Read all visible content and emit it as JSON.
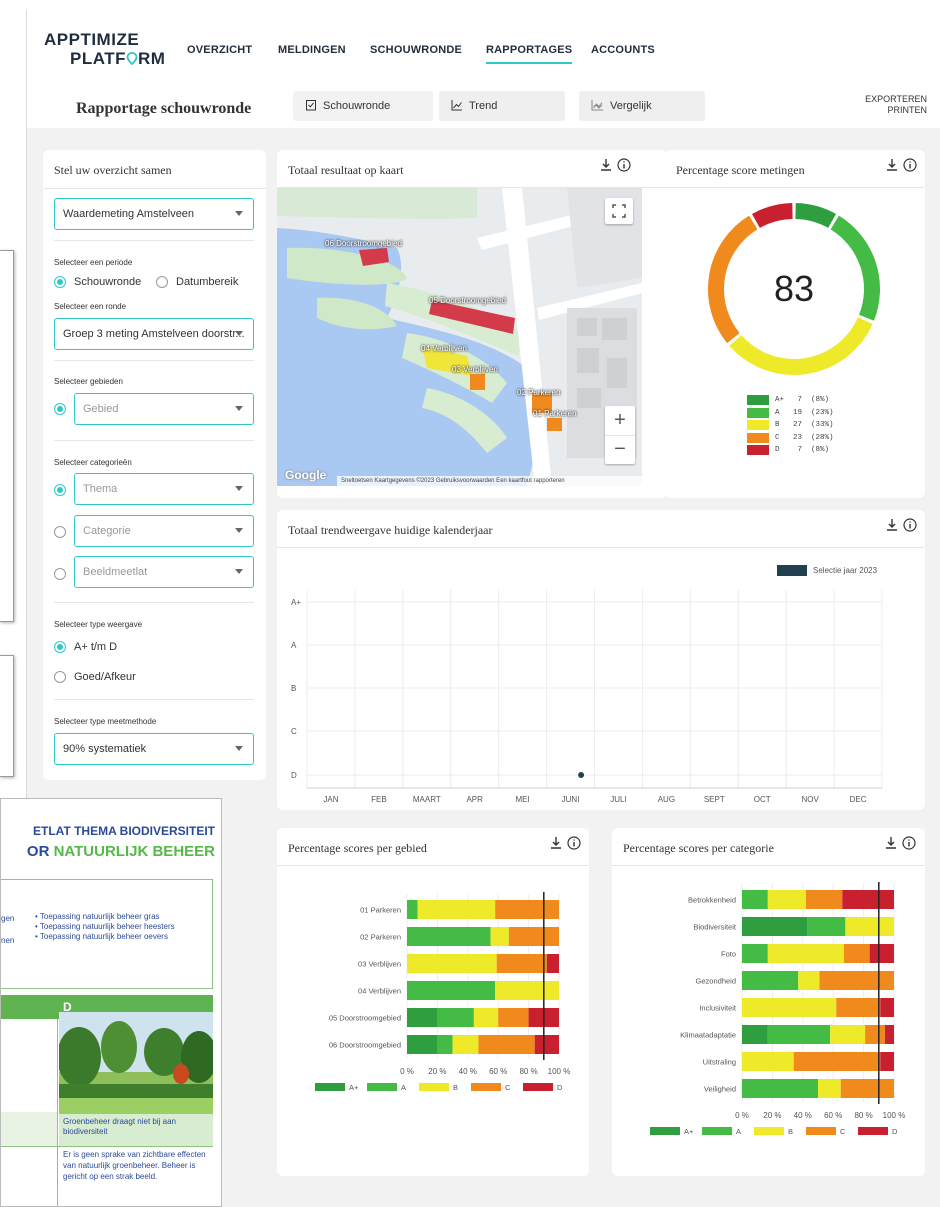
{
  "app": {
    "logo_line1": "APPTIMIZE",
    "logo_line2": "PLATF",
    "logo_line2_end": "RM",
    "nav": [
      "OVERZICHT",
      "MELDINGEN",
      "SCHOUWRONDE",
      "RAPPORTAGES",
      "ACCOUNTS"
    ],
    "nav_active": "RAPPORTAGES"
  },
  "subbar": {
    "title": "Rapportage schouwronde",
    "tabs": [
      "Schouwronde",
      "Trend",
      "Vergelijk"
    ],
    "export": "EXPORTEREN",
    "print": "PRINTEN"
  },
  "filters": {
    "title": "Stel uw overzicht samen",
    "measurement": "Waardemeting Amstelveen",
    "period_label": "Selecteer een periode",
    "period_options": [
      "Schouwronde",
      "Datumbereik"
    ],
    "round_label": "Selecteer een ronde",
    "round_value": "Groep 3 meting Amstelveen doorstr...",
    "areas_label": "Selecteer gebieden",
    "area_placeholder": "Gebied",
    "categories_label": "Selecteer categorieën",
    "category_options": [
      "Thema",
      "Categorie",
      "Beeldmeetlat"
    ],
    "display_label": "Selecteer type weergave",
    "display_options": [
      "A+ t/m D",
      "Goed/Afkeur"
    ],
    "method_label": "Selecteer type meetmethode",
    "method_value": "90% systematiek"
  },
  "map": {
    "title": "Totaal resultaat op kaart",
    "labels": [
      "06 Doorstroomgebied",
      "05 Doorstroomgebied",
      "04 Verblijven",
      "03 Verblijven",
      "02 Parkeren",
      "01 Parkeren"
    ],
    "google": "Google",
    "attribution": "Sneltoetsen   Kaartgegevens ©2023   Gebruiksvoorwaarden   Een kaartfout rapporteren",
    "zoom_in": "+",
    "zoom_out": "−"
  },
  "donut": {
    "title": "Percentage score metingen",
    "score": "83",
    "legend": [
      {
        "grade": "A+",
        "count": "7",
        "pct": "(8%)",
        "color": "#2e9e3e"
      },
      {
        "grade": "A",
        "count": "19",
        "pct": "(23%)",
        "color": "#44bb44"
      },
      {
        "grade": "B",
        "count": "27",
        "pct": "(33%)",
        "color": "#eeea2a"
      },
      {
        "grade": "C",
        "count": "23",
        "pct": "(28%)",
        "color": "#f08a1c"
      },
      {
        "grade": "D",
        "count": "7",
        "pct": "(8%)",
        "color": "#c8202e"
      }
    ]
  },
  "trend": {
    "title": "Totaal trendweergave huidige kalenderjaar",
    "legend": "Selectie jaar 2023",
    "yticks": [
      "A+",
      "A",
      "B",
      "C",
      "D"
    ],
    "xticks": [
      "JAN",
      "FEB",
      "MAART",
      "APR",
      "MEI",
      "JUNI",
      "JULI",
      "AUG",
      "SEPT",
      "OCT",
      "NOV",
      "DEC"
    ]
  },
  "chart_data": [
    {
      "type": "pie",
      "title": "Percentage score metingen",
      "categories": [
        "A+",
        "A",
        "B",
        "C",
        "D"
      ],
      "values": [
        7,
        19,
        27,
        23,
        7
      ],
      "colors": [
        "#2e9e3e",
        "#44bb44",
        "#eeea2a",
        "#f08a1c",
        "#c8202e"
      ]
    },
    {
      "type": "scatter",
      "title": "Totaal trendweergave huidige kalenderjaar",
      "series": [
        {
          "name": "Selectie jaar 2023",
          "x": [
            "JUNI"
          ],
          "y": [
            "D"
          ]
        }
      ]
    },
    {
      "type": "bar",
      "title": "Percentage scores per gebied",
      "categories": [
        "01 Parkeren",
        "02 Parkeren",
        "03 Verblijven",
        "04 Verblijven",
        "05 Doorstroomgebied",
        "06 Doorstroomgebied"
      ],
      "series": [
        {
          "name": "A+",
          "values": [
            0,
            0,
            0,
            0,
            20,
            20
          ]
        },
        {
          "name": "A",
          "values": [
            7,
            55,
            0,
            58,
            24,
            10
          ]
        },
        {
          "name": "B",
          "values": [
            51,
            12,
            59,
            42,
            16,
            17
          ]
        },
        {
          "name": "C",
          "values": [
            42,
            33,
            33,
            0,
            20,
            37
          ]
        },
        {
          "name": "D",
          "values": [
            0,
            0,
            8,
            0,
            20,
            16
          ]
        }
      ],
      "xticks": [
        "0 %",
        "20 %",
        "40 %",
        "60 %",
        "80 %",
        "100 %"
      ],
      "ylim": [
        0,
        100
      ],
      "threshold": 90
    },
    {
      "type": "bar",
      "title": "Percentage scores per categorie",
      "categories": [
        "Betrokkenheid",
        "Biodiversiteit",
        "Foto",
        "Gezondheid",
        "Inclusiviteit",
        "Klimaatadaptatie",
        "Uitstraling",
        "Veiligheid"
      ],
      "series": [
        {
          "name": "A+",
          "values": [
            0,
            43,
            0,
            0,
            0,
            17,
            0,
            0
          ]
        },
        {
          "name": "A",
          "values": [
            17,
            25,
            17,
            37,
            0,
            41,
            0,
            50
          ]
        },
        {
          "name": "B",
          "values": [
            25,
            32,
            50,
            14,
            62,
            23,
            34,
            15
          ]
        },
        {
          "name": "C",
          "values": [
            24,
            0,
            17,
            49,
            29,
            13,
            57,
            35
          ]
        },
        {
          "name": "D",
          "values": [
            34,
            0,
            16,
            0,
            9,
            6,
            9,
            0
          ]
        }
      ],
      "xticks": [
        "0 %",
        "20 %",
        "40 %",
        "60 %",
        "80 %",
        "100 %"
      ],
      "ylim": [
        0,
        100
      ],
      "threshold": 90
    }
  ],
  "area_chart": {
    "title": "Percentage scores per gebied"
  },
  "category_chart": {
    "title": "Percentage scores per categorie"
  },
  "bar_legend": [
    "A+",
    "A",
    "B",
    "C",
    "D"
  ],
  "bar_colors": [
    "#2e9e3e",
    "#44bb44",
    "#eeea2a",
    "#f08a1c",
    "#c8202e"
  ],
  "doc": {
    "header1a": "ETLAT THEMA ",
    "header1b": "BIODIVERSITEIT",
    "header2a": "OR ",
    "header2b": "NATUURLIJK BEHEER",
    "left_frag1": "gen",
    "left_frag2": "nen",
    "bullets": [
      "Toepassing natuurlijk beheer gras",
      "Toepassing natuurlijk beheer heesters",
      "Toepassing natuurlijk beheer oevers"
    ],
    "grade": "D",
    "caption": "Groenbeheer draagt niet bij aan biodiversiteit",
    "body": "Er is geen sprake van zichtbare effecten van natuurlijk groenbeheer. Beheer is gericht op een strak beeld."
  }
}
